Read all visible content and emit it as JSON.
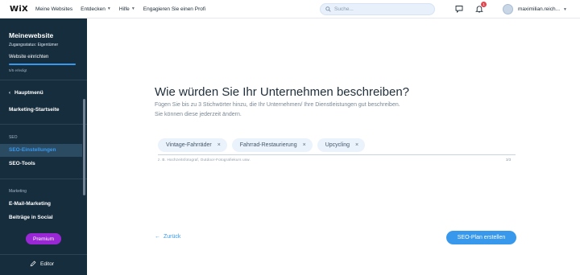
{
  "topbar": {
    "logo": "WiX",
    "nav": [
      {
        "label": "Meine Websites",
        "has_chevron": false
      },
      {
        "label": "Entdecken",
        "has_chevron": true
      },
      {
        "label": "Hilfe",
        "has_chevron": true
      },
      {
        "label": "Engagieren Sie einen Profi",
        "has_chevron": false
      }
    ],
    "search_placeholder": "Suche...",
    "notification_count": "1",
    "user_name": "maximilian.reich..."
  },
  "sidebar": {
    "site_title": "Meinewebsite",
    "access_status": "Zugangsstatus: Eigentümer",
    "setup_label": "Website einrichten",
    "setup_progress": 1.0,
    "setup_progress_text": "5/5 erledigt",
    "back_label": "Hauptmenü",
    "marketing_home": "Marketing-Startseite",
    "section_seo": "SEO",
    "seo_settings": "SEO-Einstellungen",
    "seo_tools": "SEO-Tools",
    "section_marketing": "Marketing",
    "email_marketing": "E-Mail-Marketing",
    "social_posts": "Beiträge in Social",
    "premium_label": "Premium",
    "editor_label": "Editor"
  },
  "main": {
    "title": "Wie würden Sie Ihr Unternehmen beschreiben?",
    "subtitle_line1": "Fügen Sie bis zu 3 Stichwörter hinzu, die Ihr Unternehmen/ Ihre Dienstleistungen gut beschreiben.",
    "subtitle_line2": "Sie können diese jederzeit ändern.",
    "tags": [
      "Vintage-Fahrräder",
      "Fahrrad-Restaurierung",
      "Upcycling"
    ],
    "input_hint": "z. B. Hochzeitsfotograf, Outdoor-Fotografiekurs usw.",
    "counter": "3/3",
    "back_label": "Zurück",
    "submit_label": "SEO-Plan erstellen"
  },
  "colors": {
    "accent": "#3899ec",
    "sidebar_bg": "#162d3d",
    "premium": "#9a27d5"
  }
}
